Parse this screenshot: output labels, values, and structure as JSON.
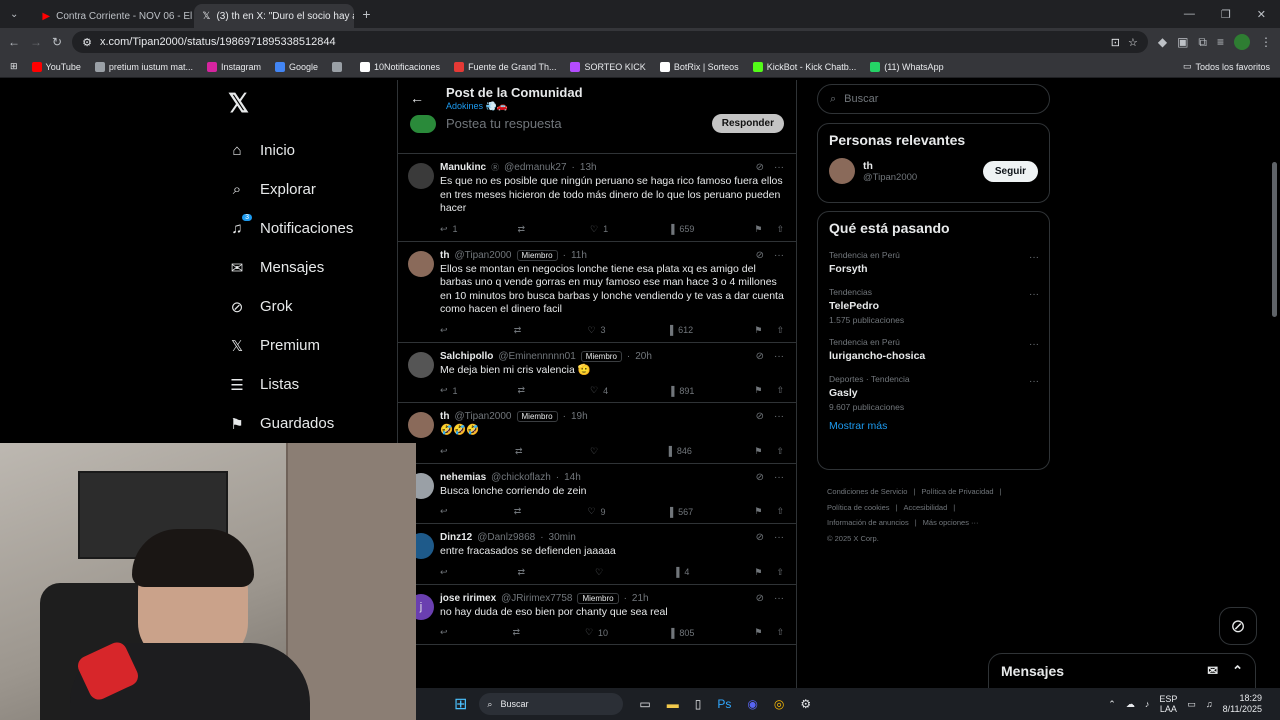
{
  "tabs": [
    {
      "title": "Contra Corriente - NOV 06 - El",
      "icon": "youtube-icon",
      "color": "#ff0000"
    },
    {
      "title": "(3) th en X: \"Duro el socio hay a",
      "icon": "x-icon",
      "color": "#ffffff"
    }
  ],
  "address": {
    "url": "x.com/Tipan2000/status/1986971895338512844"
  },
  "bookmarks": [
    {
      "label": "YouTube",
      "color": "#ff0000"
    },
    {
      "label": "pretium iustum mat...",
      "color": "#9aa0a6"
    },
    {
      "label": "Instagram",
      "color": "#d6249f"
    },
    {
      "label": "Google",
      "color": "#4285f4"
    },
    {
      "label": "",
      "color": "#9aa0a6"
    },
    {
      "label": "10Notificaciones",
      "color": "#ffffff"
    },
    {
      "label": "Fuente de Grand Th...",
      "color": "#e53935"
    },
    {
      "label": "SORTEO KICK",
      "color": "#b44cff"
    },
    {
      "label": "BotRix | Sorteos",
      "color": "#ffffff"
    },
    {
      "label": "KickBot - Kick Chatb...",
      "color": "#53fc18"
    },
    {
      "label": "(11) WhatsApp",
      "color": "#25d366"
    }
  ],
  "bookmarks_all": "Todos los favoritos",
  "nav": {
    "logo": "𝕏",
    "items": [
      {
        "label": "Inicio",
        "icon": "home-icon",
        "glyph": "⌂"
      },
      {
        "label": "Explorar",
        "icon": "search-icon",
        "glyph": "⌕"
      },
      {
        "label": "Notificaciones",
        "icon": "bell-icon",
        "glyph": "♫",
        "badge": "3"
      },
      {
        "label": "Mensajes",
        "icon": "envelope-icon",
        "glyph": "✉"
      },
      {
        "label": "Grok",
        "icon": "grok-icon",
        "glyph": "⊘"
      },
      {
        "label": "Premium",
        "icon": "x-premium-icon",
        "glyph": "𝕏"
      },
      {
        "label": "Listas",
        "icon": "list-icon",
        "glyph": "☰"
      },
      {
        "label": "Guardados",
        "icon": "bookmark-icon",
        "glyph": "⚑"
      }
    ]
  },
  "header": {
    "title": "Post de la Comunidad",
    "subtitle": "Adokines 💨🚗"
  },
  "composer": {
    "placeholder": "Postea tu respuesta",
    "button": "Responder"
  },
  "posts": [
    {
      "name": "Manukinc",
      "handle": "@edmanuk27",
      "time": "13h",
      "member": "",
      "text": "Es que no es posible que ningún peruano se haga rico famoso fuera ellos en tres meses hicieron de todo más dinero de lo que los peruano pueden hacer",
      "replies": "1",
      "reposts": "",
      "likes": "1",
      "views": "659",
      "avatar_color": "#3a3a3a"
    },
    {
      "name": "th",
      "handle": "@Tipan2000",
      "time": "11h",
      "member": "Miembro",
      "text": "Ellos se montan en negocios lonche tiene esa plata xq es amigo del barbas uno q vende gorras en muy famoso ese man hace 3 o 4 millones en 10 minutos bro busca barbas y lonche vendiendo y te vas a dar cuenta como hacen el dinero facil",
      "replies": "",
      "reposts": "",
      "likes": "3",
      "views": "612",
      "avatar_color": "#8a6a5a"
    },
    {
      "name": "Salchipollo",
      "handle": "@Eminennnnn01",
      "time": "20h",
      "member": "Miembro",
      "text": "Me deja bien mi cris valencia 🫡",
      "replies": "1",
      "reposts": "",
      "likes": "4",
      "views": "891",
      "avatar_color": "#555555"
    },
    {
      "name": "th",
      "handle": "@Tipan2000",
      "time": "19h",
      "member": "Miembro",
      "text": "🤣🤣🤣",
      "replies": "",
      "reposts": "",
      "likes": "",
      "views": "846",
      "avatar_color": "#8a6a5a"
    },
    {
      "name": "nehemias",
      "handle": "@chickoflazh",
      "time": "14h",
      "member": "",
      "text": "Busca lonche corriendo de zein",
      "replies": "",
      "reposts": "",
      "likes": "9",
      "views": "567",
      "avatar_color": "#9aa0a6"
    },
    {
      "name": "Dinz12",
      "handle": "@Danlz9868",
      "time": "30min",
      "member": "",
      "text": "entre fracasados se defienden jaaaaa",
      "replies": "",
      "reposts": "",
      "likes": "",
      "views": "4",
      "avatar_color": "#1e5a8a"
    },
    {
      "name": "jose ririmex",
      "handle": "@JRirimex7758",
      "time": "21h",
      "member": "Miembro",
      "text": "no hay duda de eso bien por chanty que sea real",
      "replies": "",
      "reposts": "",
      "likes": "10",
      "views": "805",
      "avatar_color": "#6a3fb0",
      "initial": "j"
    }
  ],
  "right": {
    "search_placeholder": "Buscar",
    "relevant_title": "Personas relevantes",
    "relevant": {
      "name": "th",
      "handle": "@Tipan2000",
      "follow": "Seguir"
    },
    "trends_title": "Qué está pasando",
    "trends": [
      {
        "meta": "Tendencia en Perú",
        "title": "Forsyth",
        "count": ""
      },
      {
        "meta": "Tendencias",
        "title": "TelePedro",
        "count": "1.575 publicaciones"
      },
      {
        "meta": "Tendencia en Perú",
        "title": "lurigancho-chosica",
        "count": ""
      },
      {
        "meta": "Deportes · Tendencia",
        "title": "Gasly",
        "count": "9.607 publicaciones"
      }
    ],
    "show_more": "Mostrar más",
    "footer": [
      "Condiciones de Servicio",
      "|",
      "Política de Privacidad",
      "|",
      "Política de cookies",
      "|",
      "Accesibilidad",
      "|",
      "Información de anuncios",
      "|",
      "Más opciones ···",
      "© 2025 X Corp."
    ]
  },
  "messages_title": "Mensajes",
  "taskbar": {
    "search": "Buscar",
    "lang1": "ESP",
    "lang2": "LAA",
    "time": "18:29",
    "date": "8/11/2025"
  }
}
